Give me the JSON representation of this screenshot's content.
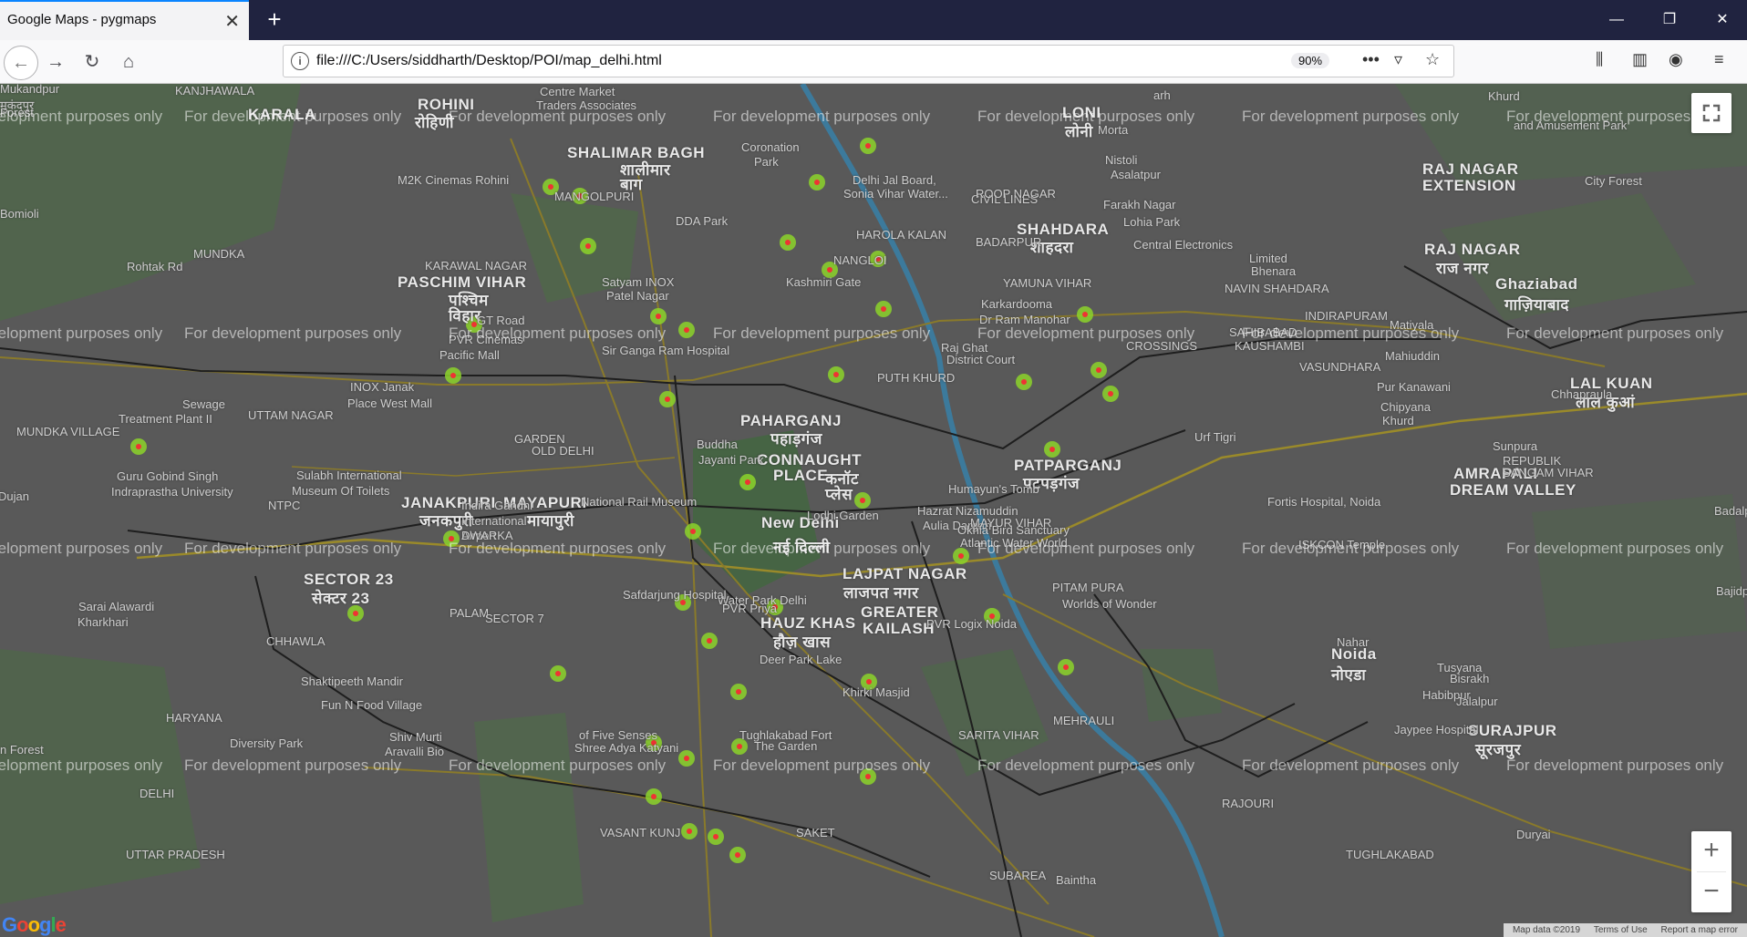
{
  "browser": {
    "tab_title": "Google Maps - pygmaps",
    "tab_close": "✕",
    "new_tab": "+",
    "url": "file:///C:/Users/siddharth/Desktop/POI/map_delhi.html",
    "zoom": "90%",
    "window_controls": {
      "minimize": "—",
      "restore": "❐",
      "close": "✕"
    }
  },
  "map": {
    "watermark": "For development purposes only",
    "google_logo": "Google",
    "attribution": {
      "data": "Map data ©2019",
      "terms": "Terms of Use",
      "report": "Report a map error"
    },
    "zoom_in": "+",
    "zoom_out": "−",
    "place_labels": [
      {
        "text": "ROHINI",
        "big": true
      },
      {
        "text": "रोहिणी",
        "big": true
      },
      {
        "text": "SHALIMAR BAGH",
        "big": true
      },
      {
        "text": "शालीमार",
        "big": true
      },
      {
        "text": "बाग",
        "big": true
      },
      {
        "text": "KARALA",
        "big": true
      },
      {
        "text": "LONI",
        "big": true
      },
      {
        "text": "लोनी",
        "big": true
      },
      {
        "text": "PASCHIM VIHAR",
        "big": true
      },
      {
        "text": "पश्चिम",
        "big": true
      },
      {
        "text": "विहार",
        "big": true
      },
      {
        "text": "JANAKPURI",
        "big": true
      },
      {
        "text": "जनकपुरी",
        "big": true
      },
      {
        "text": "MAYAPURI",
        "big": true
      },
      {
        "text": "मायापुरी",
        "big": true
      },
      {
        "text": "PAHARGANJ",
        "big": true
      },
      {
        "text": "पहाड़गंज",
        "big": true
      },
      {
        "text": "CONNAUGHT",
        "big": true
      },
      {
        "text": "PLACE",
        "big": true
      },
      {
        "text": "कनॉट",
        "big": true
      },
      {
        "text": "प्लेस",
        "big": true
      },
      {
        "text": "New Delhi",
        "big": true
      },
      {
        "text": "नई दिल्ली",
        "big": true
      },
      {
        "text": "SHAHDARA",
        "big": true
      },
      {
        "text": "शाहदरा",
        "big": true
      },
      {
        "text": "PATPARGANJ",
        "big": true
      },
      {
        "text": "पटपड़गंज",
        "big": true
      },
      {
        "text": "RAJ NAGAR",
        "big": true
      },
      {
        "text": "EXTENSION",
        "big": true
      },
      {
        "text": "RAJ NAGAR",
        "big": true
      },
      {
        "text": "राज नगर",
        "big": true
      },
      {
        "text": "Ghaziabad",
        "big": true
      },
      {
        "text": "गाज़ियाबाद",
        "big": true
      },
      {
        "text": "LAL KUAN",
        "big": true
      },
      {
        "text": "लाल कुआं",
        "big": true
      },
      {
        "text": "AMRAPALI",
        "big": true
      },
      {
        "text": "DREAM VALLEY",
        "big": true
      },
      {
        "text": "LAJPAT NAGAR",
        "big": true
      },
      {
        "text": "लाजपत नगर",
        "big": true
      },
      {
        "text": "HAUZ KHAS",
        "big": true
      },
      {
        "text": "हौज़ खास",
        "big": true
      },
      {
        "text": "GREATER",
        "big": true
      },
      {
        "text": "KAILASH",
        "big": true
      },
      {
        "text": "SECTOR 23",
        "big": true
      },
      {
        "text": "सेक्टर 23",
        "big": true
      },
      {
        "text": "Noida",
        "big": true
      },
      {
        "text": "नोएडा",
        "big": true
      },
      {
        "text": "SURAJPUR",
        "big": true
      },
      {
        "text": "सूरजपुर",
        "big": true
      },
      {
        "text": "Mukandpur",
        "big": false
      },
      {
        "text": "मुकंदपुर",
        "big": false
      },
      {
        "text": "KANJHAWALA",
        "big": false
      },
      {
        "text": "Centre Market",
        "big": false
      },
      {
        "text": "Traders Associates",
        "big": false
      },
      {
        "text": "Coronation",
        "big": false
      },
      {
        "text": "Park",
        "big": false
      },
      {
        "text": "M2K Cinemas Rohini",
        "big": false
      },
      {
        "text": "Delhi Jal Board,",
        "big": false
      },
      {
        "text": "Sonia Vihar Water...",
        "big": false
      },
      {
        "text": "DDA Park",
        "big": false
      },
      {
        "text": "Kashmiri Gate",
        "big": false
      },
      {
        "text": "Satyam INOX",
        "big": false
      },
      {
        "text": "Patel Nagar",
        "big": false
      },
      {
        "text": "PVR Cinemas",
        "big": false
      },
      {
        "text": "Pacific Mall",
        "big": false
      },
      {
        "text": "INOX Janak",
        "big": false
      },
      {
        "text": "Place West Mall",
        "big": false
      },
      {
        "text": "Sir Ganga Ram Hospital",
        "big": false
      },
      {
        "text": "Sewage",
        "big": false
      },
      {
        "text": "Treatment Plant II",
        "big": false
      },
      {
        "text": "Guru Gobind Singh",
        "big": false
      },
      {
        "text": "Indraprastha University",
        "big": false
      },
      {
        "text": "Sulabh International",
        "big": false
      },
      {
        "text": "Museum Of Toilets",
        "big": false
      },
      {
        "text": "Buddha",
        "big": false
      },
      {
        "text": "Jayanti Park",
        "big": false
      },
      {
        "text": "National Rail Museum",
        "big": false
      },
      {
        "text": "Indira Gandhi",
        "big": false
      },
      {
        "text": "International",
        "big": false
      },
      {
        "text": "Airport",
        "big": false
      },
      {
        "text": "Lodhi Garden",
        "big": false
      },
      {
        "text": "Humayun's Tomb",
        "big": false
      },
      {
        "text": "Hazrat Nizamuddin",
        "big": false
      },
      {
        "text": "Aulia Dargah",
        "big": false
      },
      {
        "text": "Raj Ghat",
        "big": false
      },
      {
        "text": "District Court",
        "big": false
      },
      {
        "text": "Karkardooma",
        "big": false
      },
      {
        "text": "Dr Ram Manohar",
        "big": false
      },
      {
        "text": "Lohia Park",
        "big": false
      },
      {
        "text": "Central Electronics",
        "big": false
      },
      {
        "text": "Limited",
        "big": false
      },
      {
        "text": "Bhenara",
        "big": false
      },
      {
        "text": "Khurd",
        "big": false
      },
      {
        "text": "and Amusement Park",
        "big": false
      },
      {
        "text": "Morta",
        "big": false
      },
      {
        "text": "Nistoli",
        "big": false
      },
      {
        "text": "Asalatpur",
        "big": false
      },
      {
        "text": "Farakh Nagar",
        "big": false
      },
      {
        "text": "City Forest",
        "big": false
      },
      {
        "text": "Matiyala",
        "big": false
      },
      {
        "text": "Mahiuddin",
        "big": false
      },
      {
        "text": "Pur Kanawani",
        "big": false
      },
      {
        "text": "Chipyana",
        "big": false
      },
      {
        "text": "Khurd",
        "big": false
      },
      {
        "text": "Urf Tigri",
        "big": false
      },
      {
        "text": "Fortis Hospital, Noida",
        "big": false
      },
      {
        "text": "ISKCON Temple",
        "big": false
      },
      {
        "text": "PVR Logix Noida",
        "big": false
      },
      {
        "text": "Worlds of Wonder",
        "big": false
      },
      {
        "text": "Okhla Bird Sanctuary",
        "big": false
      },
      {
        "text": "Atlantic Water World",
        "big": false
      },
      {
        "text": "Water Park Delhi",
        "big": false
      },
      {
        "text": "Safdarjung Hospital",
        "big": false
      },
      {
        "text": "PVR Priya",
        "big": false
      },
      {
        "text": "Deer Park Lake",
        "big": false
      },
      {
        "text": "Khirki Masjid",
        "big": false
      },
      {
        "text": "Tughlakabad Fort",
        "big": false
      },
      {
        "text": "The Garden",
        "big": false
      },
      {
        "text": "of Five Senses",
        "big": false
      },
      {
        "text": "Shree Adya Katyani",
        "big": false
      },
      {
        "text": "Shaktipeeth Mandir",
        "big": false
      },
      {
        "text": "Fun N Food Village",
        "big": false
      },
      {
        "text": "Shiv Murti",
        "big": false
      },
      {
        "text": "Aravalli Bio",
        "big": false
      },
      {
        "text": "Diversity Park",
        "big": false
      },
      {
        "text": "Sarai Alawardi",
        "big": false
      },
      {
        "text": "Kharkhari",
        "big": false
      },
      {
        "text": "Nahar",
        "big": false
      },
      {
        "text": "Jaypee Hospital",
        "big": false
      },
      {
        "text": "Tusyana",
        "big": false
      },
      {
        "text": "Habibpur",
        "big": false
      },
      {
        "text": "Bisrakh",
        "big": false
      },
      {
        "text": "Jalalpur",
        "big": false
      },
      {
        "text": "Sunpura",
        "big": false
      },
      {
        "text": "Chhapraula",
        "big": false
      },
      {
        "text": "Duryai",
        "big": false
      },
      {
        "text": "Bajidpur",
        "big": false
      },
      {
        "text": "Badalp",
        "big": false
      },
      {
        "text": "Dujan",
        "big": false
      },
      {
        "text": "n Forest",
        "big": false
      },
      {
        "text": "Forest",
        "big": false
      },
      {
        "text": "Bomioli",
        "big": false
      },
      {
        "text": "arh",
        "big": false
      },
      {
        "text": "Baintha",
        "big": false
      },
      {
        "text": "NTPC",
        "big": false
      },
      {
        "text": "UTTAM NAGAR",
        "big": false
      },
      {
        "text": "MUNDKA",
        "big": false
      },
      {
        "text": "NANGLOI",
        "big": false
      },
      {
        "text": "CIVIL LINES",
        "big": false
      },
      {
        "text": "YAMUNA VIHAR",
        "big": false
      },
      {
        "text": "NAVIN SHAHDARA",
        "big": false
      },
      {
        "text": "KAUSHAMBI",
        "big": false
      },
      {
        "text": "INDIRAPURAM",
        "big": false
      },
      {
        "text": "VASUNDHARA",
        "big": false
      },
      {
        "text": "SAHIBABAD",
        "big": false
      },
      {
        "text": "MAYUR VIHAR",
        "big": false
      },
      {
        "text": "SARITA VIHAR",
        "big": false
      },
      {
        "text": "SAKET",
        "big": false
      },
      {
        "text": "MEHRAULI",
        "big": false
      },
      {
        "text": "VASANT KUNJ",
        "big": false
      },
      {
        "text": "PALAM",
        "big": false
      },
      {
        "text": "DWARKA",
        "big": false
      },
      {
        "text": "SECTOR 7",
        "big": false
      },
      {
        "text": "CHHAWLA",
        "big": false
      },
      {
        "text": "HARYANA",
        "big": false
      },
      {
        "text": "DELHI",
        "big": false
      },
      {
        "text": "UTTAR PRADESH",
        "big": false
      },
      {
        "text": "PITAM PURA",
        "big": false
      },
      {
        "text": "MANGOLPURI",
        "big": false
      },
      {
        "text": "KARAWAL NAGAR",
        "big": false
      },
      {
        "text": "BADARPUR",
        "big": false
      },
      {
        "text": "TUGHLAKABAD",
        "big": false
      },
      {
        "text": "SUBAREA",
        "big": false
      },
      {
        "text": "RAJOURI",
        "big": false
      },
      {
        "text": "GARDEN",
        "big": false
      },
      {
        "text": "OLD DELHI",
        "big": false
      },
      {
        "text": "PUTH KHURD",
        "big": false
      },
      {
        "text": "ROOP NAGAR",
        "big": false
      },
      {
        "text": "HAROLA KALAN",
        "big": false
      },
      {
        "text": "MUNDKA VILLAGE",
        "big": false
      },
      {
        "text": "Rohtak Rd",
        "big": false
      },
      {
        "text": "GT Road",
        "big": false
      },
      {
        "text": "CROSSINGS",
        "big": false
      },
      {
        "text": "REPUBLIK",
        "big": false
      },
      {
        "text": "SANGAM VIHAR",
        "big": false
      }
    ]
  }
}
